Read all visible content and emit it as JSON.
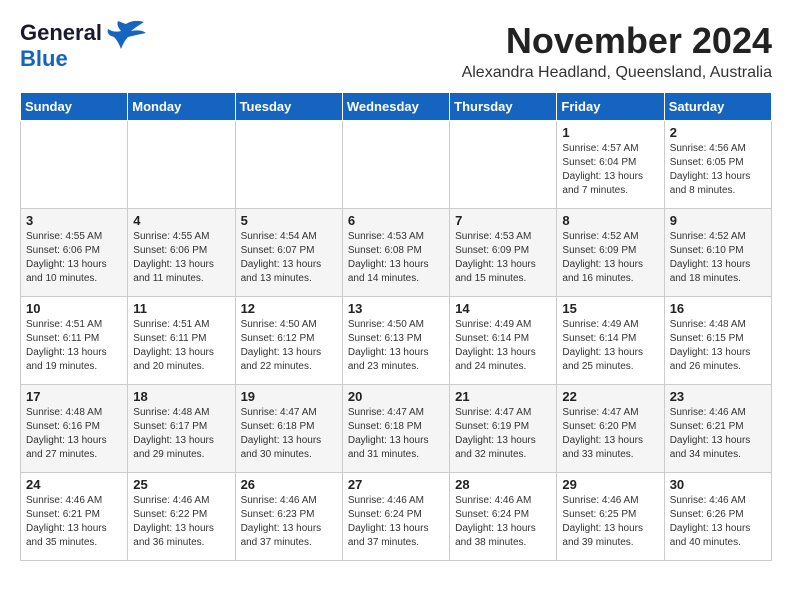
{
  "logo": {
    "line1": "General",
    "line2": "Blue"
  },
  "title": "November 2024",
  "location": "Alexandra Headland, Queensland, Australia",
  "weekdays": [
    "Sunday",
    "Monday",
    "Tuesday",
    "Wednesday",
    "Thursday",
    "Friday",
    "Saturday"
  ],
  "weeks": [
    [
      {
        "day": "",
        "text": ""
      },
      {
        "day": "",
        "text": ""
      },
      {
        "day": "",
        "text": ""
      },
      {
        "day": "",
        "text": ""
      },
      {
        "day": "",
        "text": ""
      },
      {
        "day": "1",
        "text": "Sunrise: 4:57 AM\nSunset: 6:04 PM\nDaylight: 13 hours\nand 7 minutes."
      },
      {
        "day": "2",
        "text": "Sunrise: 4:56 AM\nSunset: 6:05 PM\nDaylight: 13 hours\nand 8 minutes."
      }
    ],
    [
      {
        "day": "3",
        "text": "Sunrise: 4:55 AM\nSunset: 6:06 PM\nDaylight: 13 hours\nand 10 minutes."
      },
      {
        "day": "4",
        "text": "Sunrise: 4:55 AM\nSunset: 6:06 PM\nDaylight: 13 hours\nand 11 minutes."
      },
      {
        "day": "5",
        "text": "Sunrise: 4:54 AM\nSunset: 6:07 PM\nDaylight: 13 hours\nand 13 minutes."
      },
      {
        "day": "6",
        "text": "Sunrise: 4:53 AM\nSunset: 6:08 PM\nDaylight: 13 hours\nand 14 minutes."
      },
      {
        "day": "7",
        "text": "Sunrise: 4:53 AM\nSunset: 6:09 PM\nDaylight: 13 hours\nand 15 minutes."
      },
      {
        "day": "8",
        "text": "Sunrise: 4:52 AM\nSunset: 6:09 PM\nDaylight: 13 hours\nand 16 minutes."
      },
      {
        "day": "9",
        "text": "Sunrise: 4:52 AM\nSunset: 6:10 PM\nDaylight: 13 hours\nand 18 minutes."
      }
    ],
    [
      {
        "day": "10",
        "text": "Sunrise: 4:51 AM\nSunset: 6:11 PM\nDaylight: 13 hours\nand 19 minutes."
      },
      {
        "day": "11",
        "text": "Sunrise: 4:51 AM\nSunset: 6:11 PM\nDaylight: 13 hours\nand 20 minutes."
      },
      {
        "day": "12",
        "text": "Sunrise: 4:50 AM\nSunset: 6:12 PM\nDaylight: 13 hours\nand 22 minutes."
      },
      {
        "day": "13",
        "text": "Sunrise: 4:50 AM\nSunset: 6:13 PM\nDaylight: 13 hours\nand 23 minutes."
      },
      {
        "day": "14",
        "text": "Sunrise: 4:49 AM\nSunset: 6:14 PM\nDaylight: 13 hours\nand 24 minutes."
      },
      {
        "day": "15",
        "text": "Sunrise: 4:49 AM\nSunset: 6:14 PM\nDaylight: 13 hours\nand 25 minutes."
      },
      {
        "day": "16",
        "text": "Sunrise: 4:48 AM\nSunset: 6:15 PM\nDaylight: 13 hours\nand 26 minutes."
      }
    ],
    [
      {
        "day": "17",
        "text": "Sunrise: 4:48 AM\nSunset: 6:16 PM\nDaylight: 13 hours\nand 27 minutes."
      },
      {
        "day": "18",
        "text": "Sunrise: 4:48 AM\nSunset: 6:17 PM\nDaylight: 13 hours\nand 29 minutes."
      },
      {
        "day": "19",
        "text": "Sunrise: 4:47 AM\nSunset: 6:18 PM\nDaylight: 13 hours\nand 30 minutes."
      },
      {
        "day": "20",
        "text": "Sunrise: 4:47 AM\nSunset: 6:18 PM\nDaylight: 13 hours\nand 31 minutes."
      },
      {
        "day": "21",
        "text": "Sunrise: 4:47 AM\nSunset: 6:19 PM\nDaylight: 13 hours\nand 32 minutes."
      },
      {
        "day": "22",
        "text": "Sunrise: 4:47 AM\nSunset: 6:20 PM\nDaylight: 13 hours\nand 33 minutes."
      },
      {
        "day": "23",
        "text": "Sunrise: 4:46 AM\nSunset: 6:21 PM\nDaylight: 13 hours\nand 34 minutes."
      }
    ],
    [
      {
        "day": "24",
        "text": "Sunrise: 4:46 AM\nSunset: 6:21 PM\nDaylight: 13 hours\nand 35 minutes."
      },
      {
        "day": "25",
        "text": "Sunrise: 4:46 AM\nSunset: 6:22 PM\nDaylight: 13 hours\nand 36 minutes."
      },
      {
        "day": "26",
        "text": "Sunrise: 4:46 AM\nSunset: 6:23 PM\nDaylight: 13 hours\nand 37 minutes."
      },
      {
        "day": "27",
        "text": "Sunrise: 4:46 AM\nSunset: 6:24 PM\nDaylight: 13 hours\nand 37 minutes."
      },
      {
        "day": "28",
        "text": "Sunrise: 4:46 AM\nSunset: 6:24 PM\nDaylight: 13 hours\nand 38 minutes."
      },
      {
        "day": "29",
        "text": "Sunrise: 4:46 AM\nSunset: 6:25 PM\nDaylight: 13 hours\nand 39 minutes."
      },
      {
        "day": "30",
        "text": "Sunrise: 4:46 AM\nSunset: 6:26 PM\nDaylight: 13 hours\nand 40 minutes."
      }
    ]
  ]
}
